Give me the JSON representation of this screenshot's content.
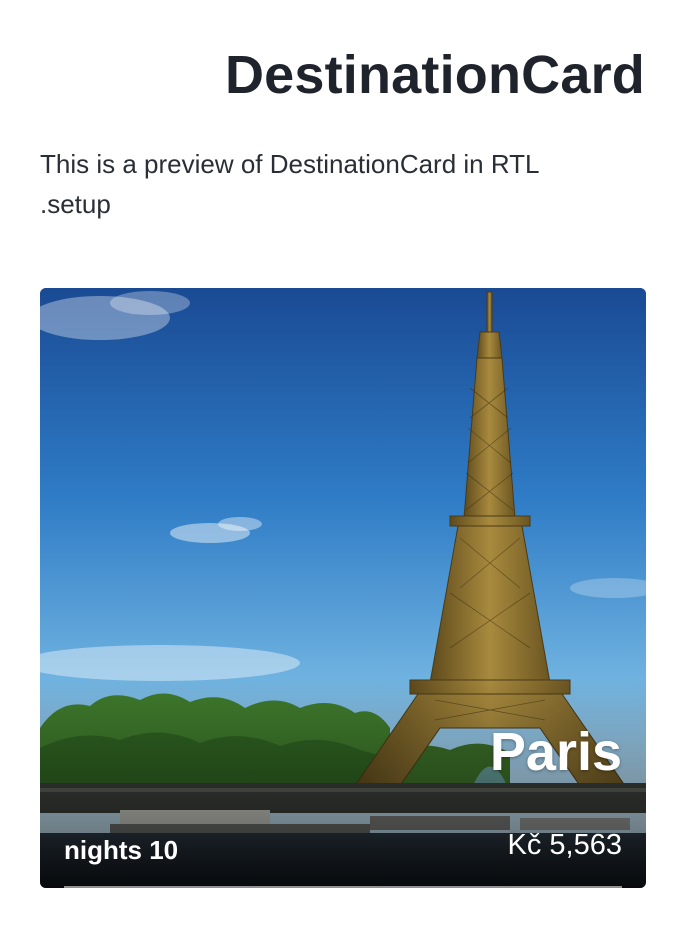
{
  "header": {
    "title": "DestinationCard"
  },
  "description": {
    "line1": "This is a preview of DestinationCard in RTL",
    "line2": ".setup"
  },
  "card": {
    "image_subject": "eiffel-tower-photo",
    "city": "Paris",
    "price": "Kč 5,563",
    "nights": "nights 10"
  },
  "colors": {
    "text_dark": "#1f232b",
    "card_text": "#ffffff",
    "sky_top": "#1d4f9a",
    "sky_bottom": "#a9d6ef",
    "tower": "#8a6f2e"
  }
}
